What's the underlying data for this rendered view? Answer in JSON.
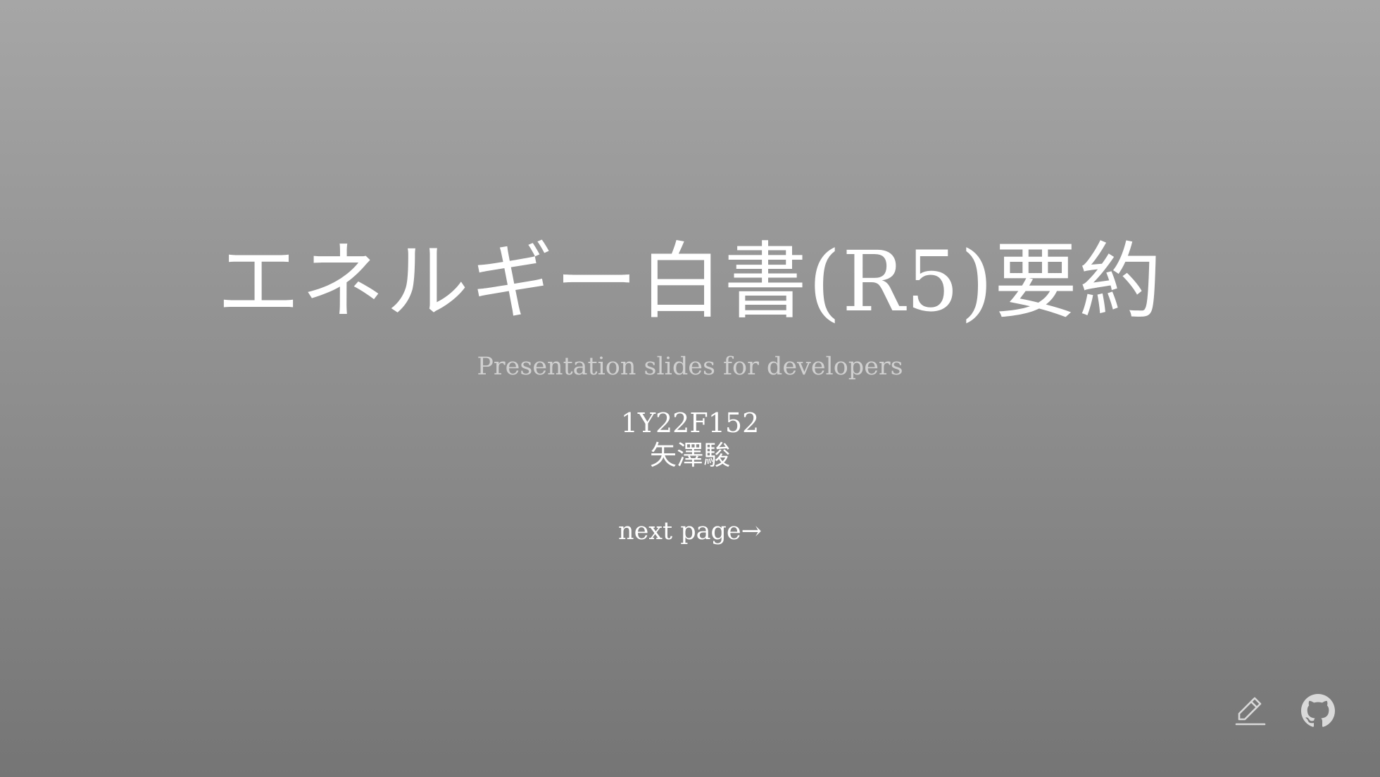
{
  "slide": {
    "title": "エネルギー白書(R5)要約",
    "subtitle": "Presentation slides for developers",
    "author_id": "1Y22F152",
    "author_name": "矢澤駿",
    "next_link": "next page→"
  },
  "toolbar": {
    "edit_icon": "pencil-icon",
    "github_icon": "github-icon"
  },
  "colors": {
    "background_top": "#a6a6a6",
    "background_bottom": "#757575",
    "text": "#ffffff",
    "subtitle": "#d0d0d0"
  }
}
